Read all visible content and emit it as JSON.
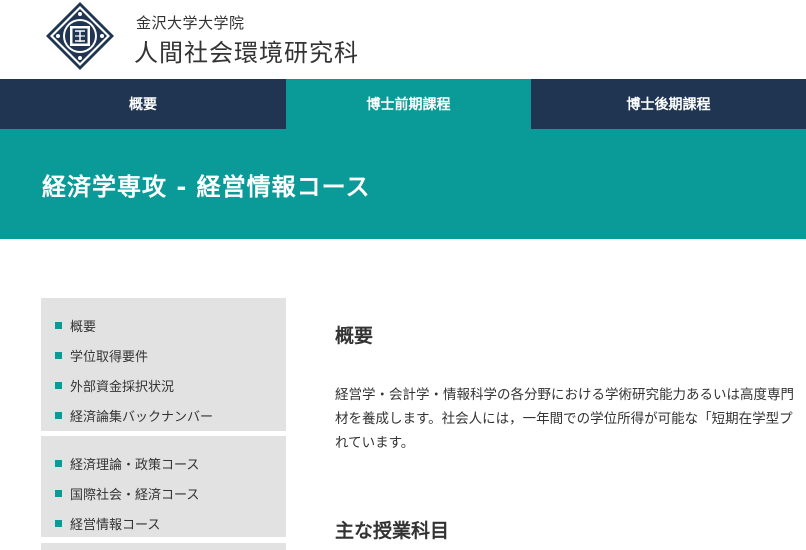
{
  "header": {
    "university": "金沢大学大学院",
    "school": "人間社会環境研究科"
  },
  "nav": {
    "items": [
      {
        "label": "概要"
      },
      {
        "label": "博士前期課程"
      },
      {
        "label": "博士後期課程"
      }
    ],
    "active_index": 1
  },
  "banner": {
    "title": "経済学専攻 - 経営情報コース"
  },
  "sidebar": {
    "group1": [
      {
        "label": "概要"
      },
      {
        "label": "学位取得要件"
      },
      {
        "label": "外部資金採択状況"
      },
      {
        "label": "経済論集バックナンバー"
      }
    ],
    "group2": [
      {
        "label": "経済理論・政策コース"
      },
      {
        "label": "国際社会・経済コース"
      },
      {
        "label": "経営情報コース"
      }
    ]
  },
  "content": {
    "overview_title": "概要",
    "overview_lines": [
      "経営学・会計学・情報科学の各分野における学術研究能力あるいは高度専門",
      "材を養成します。社会人には，一年間での学位所得が可能な「短期在学型プ",
      "れています。"
    ],
    "courses_title": "主な授業科目"
  },
  "colors": {
    "navy": "#1f3552",
    "teal": "#0a9a98",
    "sidebar_bg": "#e2e2e2"
  }
}
